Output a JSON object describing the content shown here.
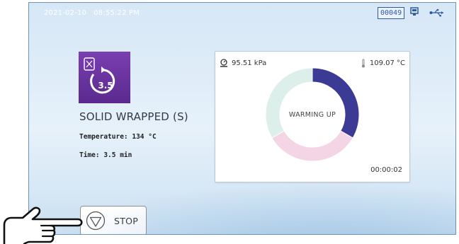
{
  "status_bar": {
    "date": "2021-02-10",
    "time": "08:55:22 PM",
    "counter": "00049",
    "icons": [
      "printer-icon",
      "usb-icon"
    ]
  },
  "program": {
    "icon": "wrapped-instrument-icon",
    "icon_badge": "3.5",
    "name": "SOLID WRAPPED (S)",
    "temperature": "Temperature: 134 °C",
    "time": "Time: 3.5 min"
  },
  "cycle_status": {
    "pressure": "95.51 kPa",
    "temperature": "109.07 °C",
    "phase": "WARMING UP",
    "elapsed": "00:00:02",
    "colors": {
      "active_segment": "#3b3a94",
      "segment_2": "#f3d5e5",
      "segment_3": "#dcefea"
    }
  },
  "controls": {
    "stop_label": "STOP"
  }
}
